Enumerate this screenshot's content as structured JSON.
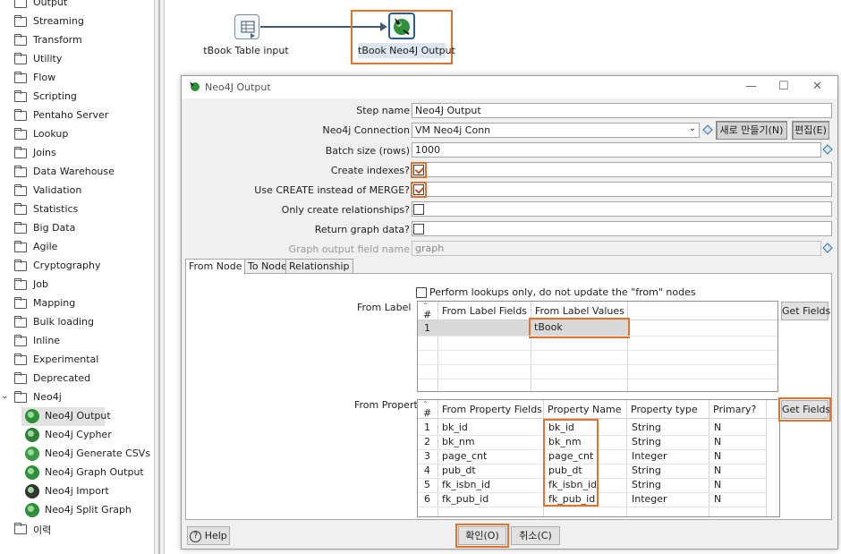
{
  "tree": {
    "folders": [
      "Output",
      "Streaming",
      "Transform",
      "Utility",
      "Flow",
      "Scripting",
      "Pentaho Server",
      "Lookup",
      "Joins",
      "Data Warehouse",
      "Validation",
      "Statistics",
      "Big Data",
      "Agile",
      "Cryptography",
      "Job",
      "Mapping",
      "Bulk loading",
      "Inline",
      "Experimental",
      "Deprecated"
    ],
    "expanded_folder": "Neo4j",
    "children": [
      "Neo4J Output",
      "Neo4j Cypher",
      "Neo4j Generate CSVs",
      "Neo4j Graph Output",
      "Neo4j Import",
      "Neo4j Split Graph"
    ],
    "selected_child": "Neo4J Output",
    "last_folder": "이력"
  },
  "canvas": {
    "step1_label": "tBook Table input",
    "step2_label": "tBook Neo4J Output"
  },
  "dialog": {
    "title": "Neo4J Output",
    "step_name_label": "Step name",
    "step_name_value": "Neo4J Output",
    "connection_label": "Neo4j Connection",
    "connection_value": "VM Neo4j Conn",
    "new_button": "새로 만들기(N)",
    "edit_button": "편집(E)",
    "batch_label": "Batch size (rows)",
    "batch_value": "1000",
    "create_indexes_label": "Create indexes?",
    "use_create_label": "Use CREATE instead of MERGE?",
    "only_rel_label": "Only create relationships?",
    "return_graph_label": "Return graph data?",
    "graph_field_label": "Graph output field name",
    "graph_field_value": "graph",
    "tabs": [
      "From Node",
      "To Node",
      "Relationship"
    ],
    "lookup_only_label": "Perform lookups only, do not update the \"from\" nodes",
    "from_label_title": "From Label",
    "from_label_table": {
      "headers": [
        "#",
        "From Label Fields",
        "From Label Values"
      ],
      "rows": [
        [
          "1",
          "",
          "tBook"
        ]
      ]
    },
    "get_fields": "Get Fields",
    "from_property_title": "From Property",
    "from_property_table": {
      "headers": [
        "#",
        "From Property Fields",
        "Property Name",
        "Property type",
        "Primary?"
      ],
      "rows": [
        [
          "1",
          "bk_id",
          "bk_id",
          "String",
          "N"
        ],
        [
          "2",
          "bk_nm",
          "bk_nm",
          "String",
          "N"
        ],
        [
          "3",
          "page_cnt",
          "page_cnt",
          "Integer",
          "N"
        ],
        [
          "4",
          "pub_dt",
          "pub_dt",
          "String",
          "N"
        ],
        [
          "5",
          "fk_isbn_id",
          "fk_isbn_id",
          "String",
          "N"
        ],
        [
          "6",
          "fk_pub_id",
          "fk_pub_id",
          "Integer",
          "N"
        ]
      ]
    },
    "help_button": "Help",
    "ok_button": "확인(O)",
    "cancel_button": "취소(C)"
  },
  "colors": {
    "highlight": "#e0742c",
    "hop": "#3f5a78"
  }
}
